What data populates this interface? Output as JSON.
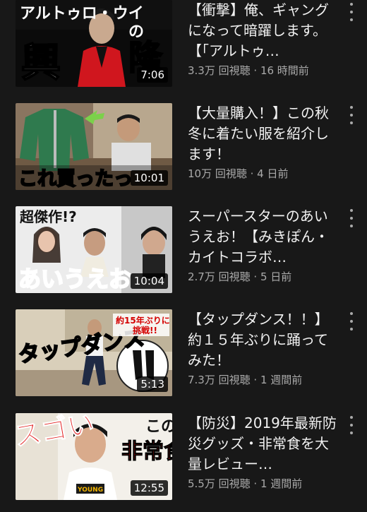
{
  "videos": [
    {
      "title": "【衝撃】俺、ギャングになって暗躍します。【「アルトゥ…",
      "views": "3.3万 回視聴",
      "age": "16 時間前",
      "duration": "7:06",
      "thumb_text": [
        "アルトゥロ・ウイ",
        "の",
        "興",
        "隆"
      ]
    },
    {
      "title": "【大量購入！】この秋冬に着たい服を紹介します！",
      "views": "10万 回視聴",
      "age": "4 日前",
      "duration": "10:01",
      "thumb_text": [
        "これ買ったっ"
      ]
    },
    {
      "title": "スーパースターのあいうえお！【みきぽん・カイトコラボ…",
      "views": "2.7万 回視聴",
      "age": "5 日前",
      "duration": "10:04",
      "thumb_text": [
        "超傑作!?",
        "あいうえお"
      ]
    },
    {
      "title": "【タップダンス！！】約１５年ぶりに踊ってみた！",
      "views": "7.3万 回視聴",
      "age": "1 週間前",
      "duration": "5:13",
      "thumb_text": [
        "タップダンス",
        "約15年ぶりに",
        "挑戦!!"
      ]
    },
    {
      "title": "【防災】2019年最新防災グッズ・非常食を大量レビュー…",
      "views": "5.5万 回視聴",
      "age": "1 週間前",
      "duration": "12:55",
      "thumb_text": [
        "スゴい",
        "この",
        "非常食"
      ]
    }
  ],
  "meta_separator": " · "
}
